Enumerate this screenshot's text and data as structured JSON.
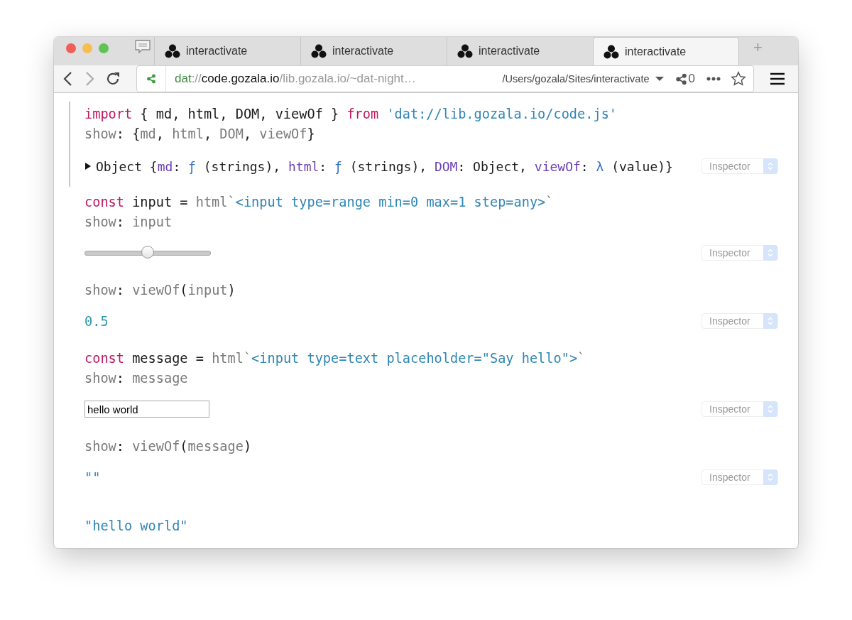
{
  "window": {
    "controls": [
      {
        "color": "#ee5f58"
      },
      {
        "color": "#f6be4f"
      },
      {
        "color": "#5fc453"
      }
    ]
  },
  "tabs": [
    {
      "label": "interactivate",
      "selected": false
    },
    {
      "label": "interactivate",
      "selected": false
    },
    {
      "label": "interactivate",
      "selected": false
    },
    {
      "label": "interactivate",
      "selected": true
    }
  ],
  "new_tab": "+",
  "address_bar": {
    "scheme": "dat",
    "separator": "://",
    "host": "code.gozala.io",
    "path": "/lib.gozala.io/~dat-night…",
    "local_path": "/Users/gozala/Sites/interactivate",
    "peers": "0"
  },
  "cells": [
    {
      "focused": true,
      "code": [
        [
          {
            "kind": "keyword",
            "text": "import"
          },
          {
            "kind": "plain",
            "text": " { md, html, DOM, viewOf } "
          },
          {
            "kind": "keyword",
            "text": "from"
          },
          {
            "kind": "string",
            "text": " 'dat://lib.gozala.io/code.js'"
          }
        ],
        [
          {
            "kind": "muted",
            "text": "show"
          },
          {
            "kind": "plain",
            "text": ": {"
          },
          {
            "kind": "muted",
            "text": "md"
          },
          {
            "kind": "plain",
            "text": ", "
          },
          {
            "kind": "muted",
            "text": "html"
          },
          {
            "kind": "plain",
            "text": ", "
          },
          {
            "kind": "muted",
            "text": "DOM"
          },
          {
            "kind": "plain",
            "text": ", "
          },
          {
            "kind": "muted",
            "text": "viewOf"
          },
          {
            "kind": "plain",
            "text": "}"
          }
        ]
      ],
      "output": {
        "kind": "object",
        "expanded": false,
        "tokens": [
          {
            "kind": "plain",
            "text": "Object {"
          },
          {
            "kind": "prop",
            "text": "md"
          },
          {
            "kind": "plain",
            "text": ": "
          },
          {
            "kind": "fn",
            "text": "ƒ"
          },
          {
            "kind": "plain",
            "text": " (strings), "
          },
          {
            "kind": "prop",
            "text": "html"
          },
          {
            "kind": "plain",
            "text": ": "
          },
          {
            "kind": "fn",
            "text": "ƒ"
          },
          {
            "kind": "plain",
            "text": " (strings), "
          },
          {
            "kind": "prop",
            "text": "DOM"
          },
          {
            "kind": "plain",
            "text": ": Object, "
          },
          {
            "kind": "prop",
            "text": "viewOf"
          },
          {
            "kind": "plain",
            "text": ": "
          },
          {
            "kind": "fn",
            "text": "λ"
          },
          {
            "kind": "plain",
            "text": " (value)}"
          }
        ],
        "inspector": "Inspector"
      }
    },
    {
      "focused": false,
      "code": [
        [
          {
            "kind": "keyword",
            "text": "const"
          },
          {
            "kind": "plain",
            "text": " input = "
          },
          {
            "kind": "muted",
            "text": "html`"
          },
          {
            "kind": "string",
            "text": "<input type=range min=0 max=1 step=any>"
          },
          {
            "kind": "muted",
            "text": "`"
          }
        ],
        [
          {
            "kind": "muted",
            "text": "show"
          },
          {
            "kind": "plain",
            "text": ": "
          },
          {
            "kind": "muted",
            "text": "input"
          }
        ]
      ],
      "output": {
        "kind": "slider",
        "level": 0.5,
        "inspector": "Inspector"
      }
    },
    {
      "focused": false,
      "code": [
        [
          {
            "kind": "muted",
            "text": "show"
          },
          {
            "kind": "plain",
            "text": ": "
          },
          {
            "kind": "muted",
            "text": "viewOf"
          },
          {
            "kind": "plain",
            "text": "("
          },
          {
            "kind": "muted",
            "text": "input"
          },
          {
            "kind": "plain",
            "text": ")"
          }
        ]
      ],
      "output": {
        "kind": "value",
        "tokens": [
          {
            "kind": "number",
            "text": "0.5"
          }
        ],
        "inspector": "Inspector"
      }
    },
    {
      "focused": false,
      "code": [
        [
          {
            "kind": "keyword",
            "text": "const"
          },
          {
            "kind": "plain",
            "text": " message = "
          },
          {
            "kind": "muted",
            "text": "html`"
          },
          {
            "kind": "string",
            "text": "<input type=text placeholder=\"Say hello\">"
          },
          {
            "kind": "muted",
            "text": "`"
          }
        ],
        [
          {
            "kind": "muted",
            "text": "show"
          },
          {
            "kind": "plain",
            "text": ": "
          },
          {
            "kind": "muted",
            "text": "message"
          }
        ]
      ],
      "output": {
        "kind": "textbox",
        "value": "hello world",
        "inspector": "Inspector"
      }
    },
    {
      "focused": false,
      "code": [
        [
          {
            "kind": "muted",
            "text": "show"
          },
          {
            "kind": "plain",
            "text": ": "
          },
          {
            "kind": "muted",
            "text": "viewOf"
          },
          {
            "kind": "plain",
            "text": "("
          },
          {
            "kind": "muted",
            "text": "message"
          },
          {
            "kind": "plain",
            "text": ")"
          }
        ]
      ],
      "output": {
        "kind": "value",
        "tokens": [
          {
            "kind": "string",
            "text": "\"\""
          }
        ],
        "inspector": "Inspector"
      }
    },
    {
      "focused": false,
      "output": {
        "kind": "value",
        "tokens": [
          {
            "kind": "string",
            "text": "\"hello world\""
          }
        ]
      }
    }
  ]
}
